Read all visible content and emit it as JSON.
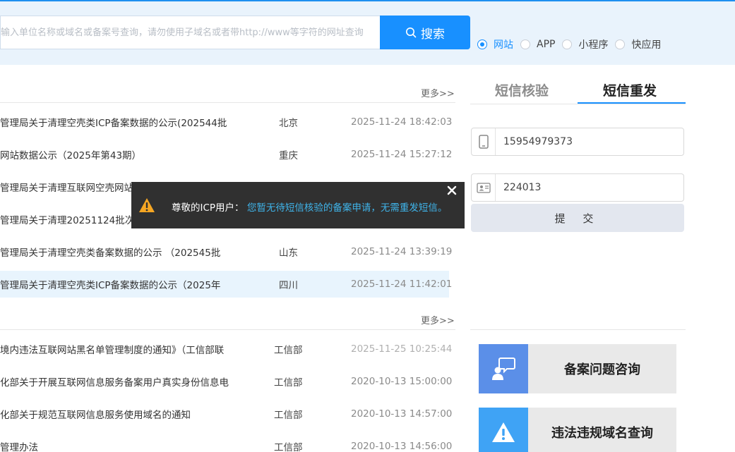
{
  "search": {
    "placeholder": "输入单位名称或域名或备案号查询，请勿使用子域名或者带http://www等字符的网址查询",
    "button_label": "搜索",
    "types": [
      {
        "label": "网站",
        "selected": true
      },
      {
        "label": "APP",
        "selected": false
      },
      {
        "label": "小程序",
        "selected": false
      },
      {
        "label": "快应用",
        "selected": false
      }
    ]
  },
  "notices": {
    "more_label": "更多>>",
    "rows": [
      {
        "title": "管理局关于清理空壳类ICP备案数据的公示(202544批",
        "region": "北京",
        "time": "2025-11-24 18:42:03"
      },
      {
        "title": "网站数据公示（2025年第43期）",
        "region": "重庆",
        "time": "2025-11-24 15:27:12"
      },
      {
        "title": "管理局关于清理互联网空壳网站",
        "region": "",
        "time": ""
      },
      {
        "title": "管理局关于清理20251124批次",
        "region": "",
        "time": ""
      },
      {
        "title": "管理局关于清理空壳类备案数据的公示 （202545批",
        "region": "山东",
        "time": "2025-11-24 13:39:19"
      },
      {
        "title": "管理局关于清理空壳类ICP备案数据的公示（2025年",
        "region": "四川",
        "time": "2025-11-24 11:42:01"
      }
    ]
  },
  "policies": {
    "more_label": "更多>>",
    "rows": [
      {
        "title": "境内违法互联网站黑名单管理制度的通知》（工信部联",
        "region": "工信部",
        "time": "2025-11-25 10:25:44"
      },
      {
        "title": "化部关于开展互联网信息服务备案用户真实身份信息电",
        "region": "工信部",
        "time": "2020-10-13 15:00:00"
      },
      {
        "title": "化部关于规范互联网信息服务使用域名的通知",
        "region": "工信部",
        "time": "2020-10-13 14:57:00"
      },
      {
        "title": "管理办法",
        "region": "工信部",
        "time": "2020-10-13 14:56:00"
      }
    ]
  },
  "sms": {
    "tab_verify": "短信核验",
    "tab_resend": "短信重发",
    "phone_value": "15954979373",
    "code_value": "224013",
    "submit_label": "提 交"
  },
  "links": [
    {
      "label": "备案问题咨询",
      "icon": "consult-icon",
      "color": "#5b8fe8"
    },
    {
      "label": "违法违规域名查询",
      "icon": "warning-icon",
      "color": "#3fa3f5"
    }
  ],
  "toast": {
    "prefix": "尊敬的ICP用户：",
    "message": "您暂无待短信核验的备案申请，无需重发短信。"
  },
  "colors": {
    "accent": "#1890ff",
    "toast_bg": "#303030",
    "toast_text": "#3fb4ea",
    "warning": "#f5a623"
  }
}
